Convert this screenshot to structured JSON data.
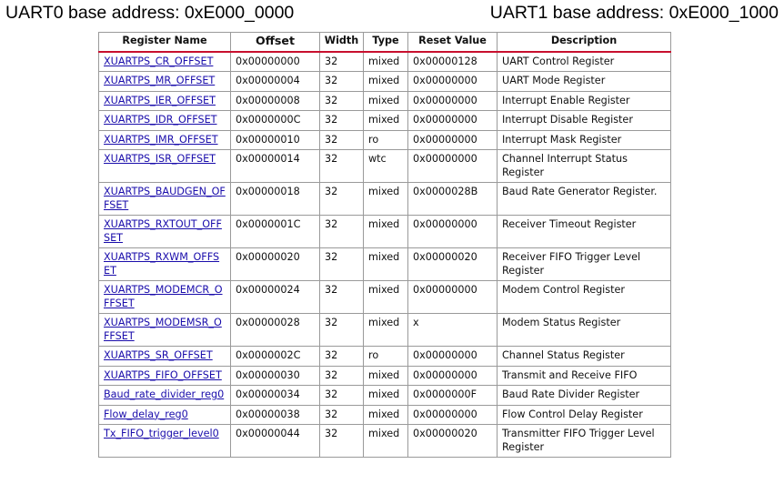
{
  "headings": {
    "uart0": "UART0 base address: 0xE000_0000",
    "uart1": "UART1 base address: 0xE000_1000"
  },
  "table": {
    "columns": [
      "Register Name",
      "Offset",
      "Width",
      "Type",
      "Reset Value",
      "Description"
    ],
    "rows": [
      {
        "name": "XUARTPS_CR_OFFSET",
        "offset": "0x00000000",
        "width": "32",
        "type": "mixed",
        "reset": "0x00000128",
        "desc": "UART Control Register"
      },
      {
        "name": "XUARTPS_MR_OFFSET",
        "offset": "0x00000004",
        "width": "32",
        "type": "mixed",
        "reset": "0x00000000",
        "desc": "UART Mode Register"
      },
      {
        "name": "XUARTPS_IER_OFFSET",
        "offset": "0x00000008",
        "width": "32",
        "type": "mixed",
        "reset": "0x00000000",
        "desc": "Interrupt Enable Register"
      },
      {
        "name": "XUARTPS_IDR_OFFSET",
        "offset": "0x0000000C",
        "width": "32",
        "type": "mixed",
        "reset": "0x00000000",
        "desc": "Interrupt Disable Register"
      },
      {
        "name": "XUARTPS_IMR_OFFSET",
        "offset": "0x00000010",
        "width": "32",
        "type": "ro",
        "reset": "0x00000000",
        "desc": "Interrupt Mask Register"
      },
      {
        "name": "XUARTPS_ISR_OFFSET",
        "offset": "0x00000014",
        "width": "32",
        "type": "wtc",
        "reset": "0x00000000",
        "desc": "Channel Interrupt Status Register"
      },
      {
        "name": "XUARTPS_BAUDGEN_OFFSET",
        "offset": "0x00000018",
        "width": "32",
        "type": "mixed",
        "reset": "0x0000028B",
        "desc": "Baud Rate Generator Register."
      },
      {
        "name": "XUARTPS_RXTOUT_OFFSET",
        "offset": "0x0000001C",
        "width": "32",
        "type": "mixed",
        "reset": "0x00000000",
        "desc": "Receiver Timeout Register"
      },
      {
        "name": "XUARTPS_RXWM_OFFSET",
        "offset": "0x00000020",
        "width": "32",
        "type": "mixed",
        "reset": "0x00000020",
        "desc": "Receiver FIFO Trigger Level Register"
      },
      {
        "name": "XUARTPS_MODEMCR_OFFSET",
        "offset": "0x00000024",
        "width": "32",
        "type": "mixed",
        "reset": "0x00000000",
        "desc": "Modem Control Register"
      },
      {
        "name": "XUARTPS_MODEMSR_OFFSET",
        "offset": "0x00000028",
        "width": "32",
        "type": "mixed",
        "reset": "x",
        "desc": "Modem Status Register"
      },
      {
        "name": "XUARTPS_SR_OFFSET",
        "offset": "0x0000002C",
        "width": "32",
        "type": "ro",
        "reset": "0x00000000",
        "desc": "Channel Status Register"
      },
      {
        "name": "XUARTPS_FIFO_OFFSET",
        "offset": "0x00000030",
        "width": "32",
        "type": "mixed",
        "reset": "0x00000000",
        "desc": "Transmit and Receive FIFO"
      },
      {
        "name": "Baud_rate_divider_reg0",
        "offset": "0x00000034",
        "width": "32",
        "type": "mixed",
        "reset": "0x0000000F",
        "desc": "Baud Rate Divider Register"
      },
      {
        "name": "Flow_delay_reg0",
        "offset": "0x00000038",
        "width": "32",
        "type": "mixed",
        "reset": "0x00000000",
        "desc": "Flow Control Delay Register"
      },
      {
        "name": "Tx_FIFO_trigger_level0",
        "offset": "0x00000044",
        "width": "32",
        "type": "mixed",
        "reset": "0x00000020",
        "desc": "Transmitter FIFO Trigger Level Register"
      }
    ]
  }
}
